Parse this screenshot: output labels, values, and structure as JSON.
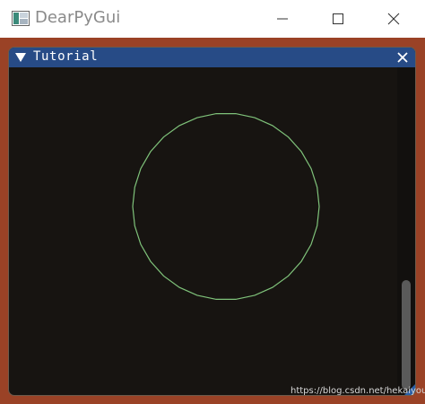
{
  "window": {
    "title": "DearPyGui",
    "icon": "dearpygui-app-icon",
    "controls": {
      "minimize_icon": "minimize-icon",
      "maximize_icon": "maximize-icon",
      "close_icon": "close-icon"
    }
  },
  "inner_window": {
    "title": "Tutorial",
    "collapse_icon": "collapse-triangle-icon",
    "close_icon": "close-icon"
  },
  "canvas": {
    "shape": "circle",
    "stroke_color": "#7fc27a"
  },
  "colors": {
    "viewport_background": "#9a4226",
    "window_background": "#171411",
    "header_background": "#274b86"
  },
  "watermark": "https://blog.csdn.net/hekaiyou"
}
